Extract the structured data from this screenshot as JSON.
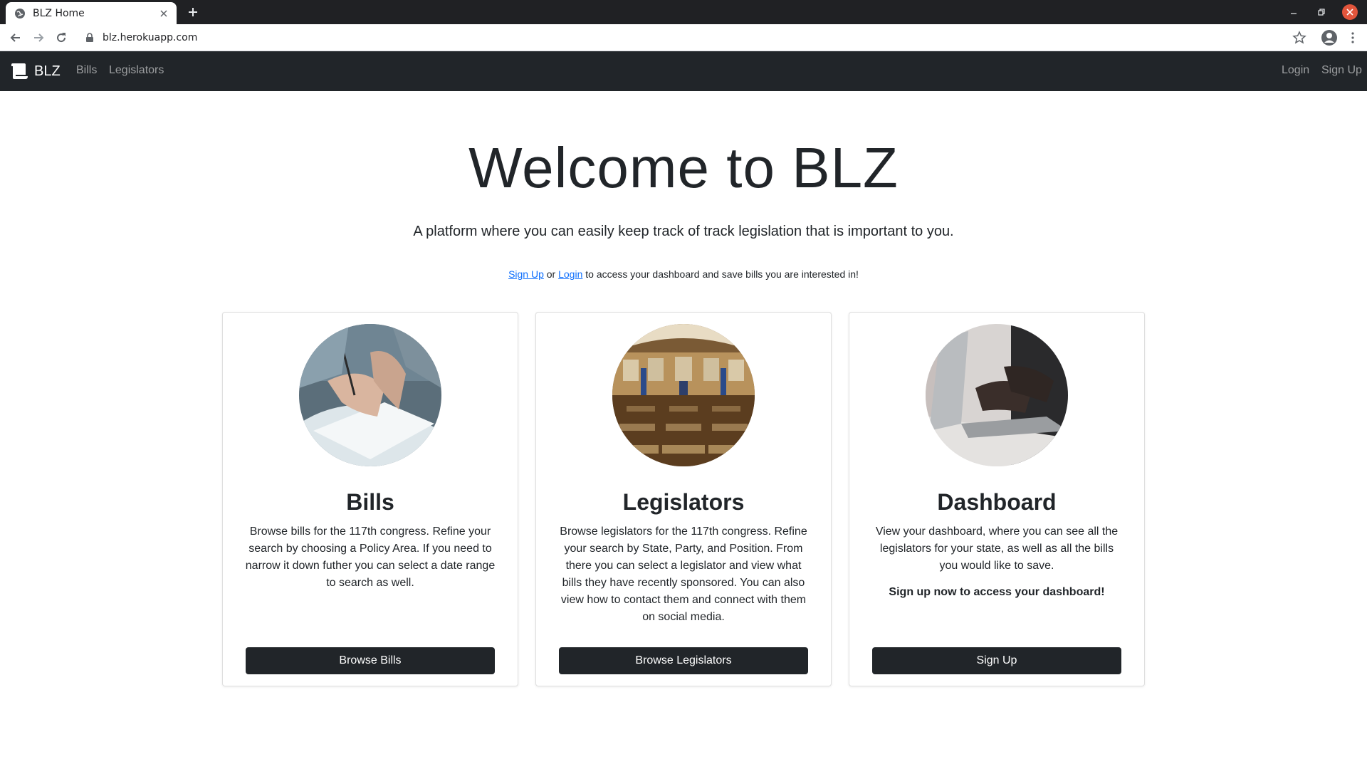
{
  "browser": {
    "tab_title": "BLZ Home",
    "url": "blz.herokuapp.com",
    "icons": [
      "favicon-icon",
      "close-icon",
      "plus-icon",
      "minimize-icon",
      "restore-icon",
      "close-window-icon",
      "back-icon",
      "forward-icon",
      "reload-icon",
      "lock-icon",
      "star-icon",
      "account-icon",
      "kebab-menu-icon"
    ]
  },
  "navbar": {
    "brand": "BLZ",
    "links": [
      "Bills",
      "Legislators"
    ],
    "login": "Login",
    "signup": "Sign Up"
  },
  "hero": {
    "title": "Welcome to BLZ",
    "lead": "A platform where you can easily keep track of track legislation that is important to you.",
    "cta_signup": "Sign Up",
    "cta_or": " or ",
    "cta_login": "Login",
    "cta_rest": " to access your dashboard and save bills you are interested in!"
  },
  "cards": [
    {
      "title": "Bills",
      "text": "Browse bills for the 117th congress. Refine your search by choosing a Policy Area. If you need to narrow it down futher you can select a date range to search as well.",
      "button": "Browse Bills",
      "image": "signing-document-photo"
    },
    {
      "title": "Legislators",
      "text": "Browse legislators for the 117th congress. Refine your search by State, Party, and Position. From there you can select a legislator and view what bills they have recently sponsored. You can also view how to contact them and connect with them on social media.",
      "button": "Browse Legislators",
      "image": "legislative-chamber-photo"
    },
    {
      "title": "Dashboard",
      "text": "View your dashboard, where you can see all the legislators for your state, as well as all the bills you would like to save.",
      "strong": "Sign up now to access your dashboard!",
      "button": "Sign Up",
      "image": "typing-laptop-photo"
    }
  ],
  "colors": {
    "navbar_bg": "#212529",
    "link": "#0d6efd",
    "button_bg": "#212529",
    "chrome_bg": "#202124",
    "close_red": "#e2553c"
  }
}
